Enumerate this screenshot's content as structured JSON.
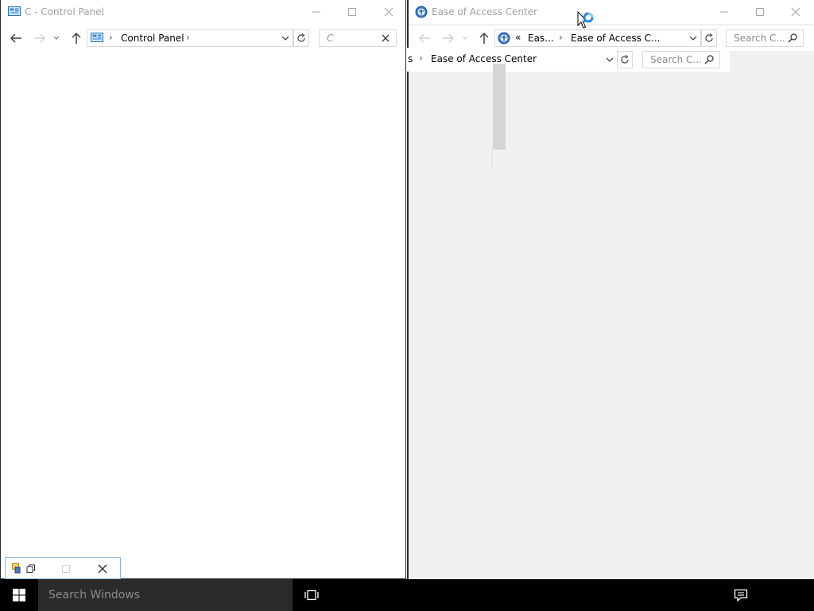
{
  "left_window": {
    "title": "C - Control Panel",
    "breadcrumb": [
      "Control Panel"
    ],
    "search_value": "C"
  },
  "right_window": {
    "title": "Ease of Access Center",
    "breadcrumb_overflow": "«",
    "breadcrumb": [
      "Eas...",
      "Ease of Access C..."
    ],
    "search_placeholder": "Search C...",
    "ghost": {
      "prefix": "s",
      "breadcrumb": "Ease of Access Center",
      "search_placeholder": "Search C..."
    }
  },
  "taskbar": {
    "search_placeholder": "Search Windows"
  },
  "colors": {
    "accent": "#0078d7",
    "taskbar": "#000000",
    "taskbar_search": "#2b2b2b",
    "workspace_gray": "#f0f0f0"
  },
  "icons": {
    "control_panel": "control-panel-icon",
    "ease_of_access": "ease-of-access-icon",
    "busy_cursor": "busy-cursor-icon"
  }
}
